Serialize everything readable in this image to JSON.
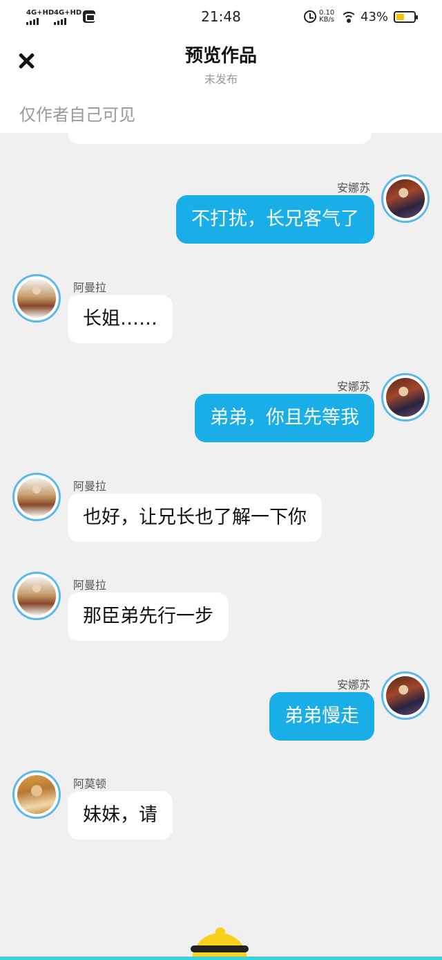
{
  "status_bar": {
    "signal1": "4G+HD",
    "signal2": "4G+HD",
    "time": "21:48",
    "speed_value": "0.10",
    "speed_unit": "KB/s",
    "battery": "43%"
  },
  "header": {
    "title": "预览作品",
    "subtitle": "未发布",
    "visibility_note": "仅作者自己可见"
  },
  "messages": [
    {
      "side": "right",
      "name": "安娜苏",
      "text": "不打扰，长兄客气了",
      "avatar": "anna-avatar"
    },
    {
      "side": "left",
      "name": "阿曼拉",
      "text": "长姐……",
      "avatar": "amanla-avatar"
    },
    {
      "side": "right",
      "name": "安娜苏",
      "text": "弟弟，你且先等我",
      "avatar": "anna-avatar"
    },
    {
      "side": "left",
      "name": "阿曼拉",
      "text": "也好，让兄长也了解一下你",
      "avatar": "amanla-avatar"
    },
    {
      "side": "left",
      "name": "阿曼拉",
      "text": "那臣弟先行一步",
      "avatar": "amanla-avatar"
    },
    {
      "side": "right",
      "name": "安娜苏",
      "text": "弟弟慢走",
      "avatar": "anna-avatar"
    },
    {
      "side": "left",
      "name": "阿莫顿",
      "text": "妹妹，请",
      "avatar": "amodun-avatar"
    }
  ],
  "colors": {
    "accent_bubble": "#1aaee8",
    "avatar_ring": "#5bb8e8",
    "background": "#f0f0f0"
  },
  "icons": [
    "close-icon",
    "alarm-icon",
    "wifi-icon",
    "battery-icon",
    "mascot-icon"
  ]
}
